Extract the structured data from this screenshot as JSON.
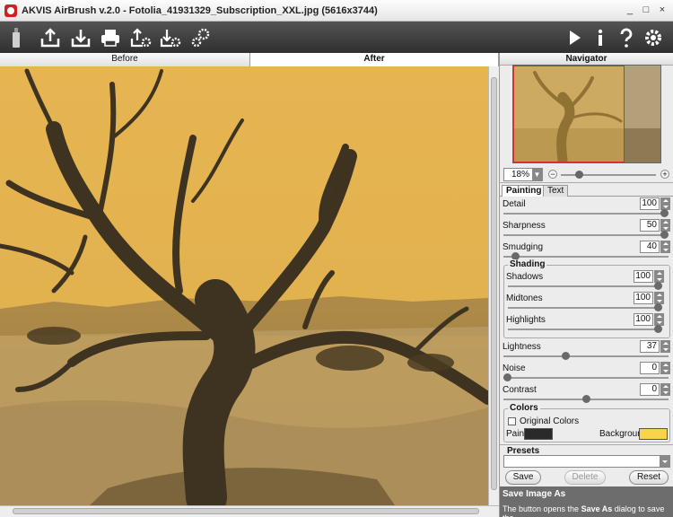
{
  "window": {
    "title": "AKVIS AirBrush v.2.0 - Fotolia_41931329_Subscription_XXL.jpg (5616x3744)"
  },
  "titlebar_buttons": [
    "_",
    "□",
    "×"
  ],
  "toolbar": {
    "left_icons": [
      "airbrush-icon",
      "open-icon",
      "save-icon",
      "print-icon",
      "import-settings-icon",
      "export-settings-icon",
      "batch-settings-icon"
    ],
    "right_icons": [
      "run-icon",
      "info-icon",
      "help-icon",
      "settings-icon"
    ]
  },
  "view_tabs": {
    "before": "Before",
    "after": "After",
    "active": "After"
  },
  "canvas": {
    "background_color": "#e2b24f"
  },
  "navigator": {
    "title": "Navigator",
    "zoom": "18%",
    "zoom_minus": "−",
    "zoom_plus": "+"
  },
  "panel_tabs": {
    "painting": "Painting",
    "text": "Text",
    "active": "Painting"
  },
  "params": {
    "detail": {
      "label": "Detail",
      "value": "100",
      "fraction": 1.0
    },
    "sharpness": {
      "label": "Sharpness",
      "value": "50",
      "fraction": 1.0
    },
    "smudging": {
      "label": "Smudging",
      "value": "40",
      "fraction": 0.05
    },
    "lightness": {
      "label": "Lightness",
      "value": "37",
      "fraction": 0.37
    },
    "noise": {
      "label": "Noise",
      "value": "0",
      "fraction": 0.0
    },
    "contrast": {
      "label": "Contrast",
      "value": "0",
      "fraction": 0.5
    }
  },
  "shading": {
    "title": "Shading",
    "shadows": {
      "label": "Shadows",
      "value": "100",
      "fraction": 1.0
    },
    "midtones": {
      "label": "Midtones",
      "value": "100",
      "fraction": 1.0
    },
    "highlights": {
      "label": "Highlights",
      "value": "100",
      "fraction": 1.0
    }
  },
  "colors": {
    "title": "Colors",
    "original_colors_label": "Original Colors",
    "original_colors_checked": false,
    "paint_label": "Paint",
    "paint_color": "#2a2a2a",
    "background_label": "Background",
    "background_color": "#f7d44a"
  },
  "presets": {
    "title": "Presets",
    "selected": "",
    "save": "Save",
    "delete": "Delete",
    "reset": "Reset"
  },
  "help": {
    "title": "Save Image As",
    "text_before": "The button opens the ",
    "text_bold": "Save As",
    "text_after": " dialog to save the"
  }
}
